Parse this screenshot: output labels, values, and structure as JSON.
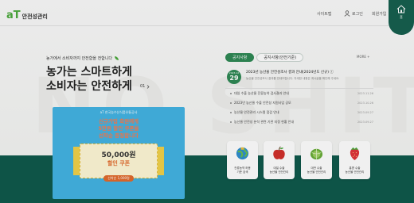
{
  "header": {
    "logo_mark": "aT",
    "logo_text": "안전성관리",
    "util_links": [
      "사이트맵",
      "로그인",
      "회원가입"
    ],
    "home_label": "홈"
  },
  "hero": {
    "tagline": "농가에서 소비자까지 안전함을 전합니다",
    "title_line1": "농가는 스마트하게",
    "title_line2": "소비자는 안전하게",
    "pager": "01"
  },
  "promo": {
    "brand": "aT 한국농수산식품유통공사",
    "headline_line1": "신규가입 회원에게",
    "headline_line2": "5만원 할인 쿠폰을",
    "headline_line3": "선착순 증정합니다",
    "ticket_amount": "50,000원",
    "ticket_desc": "할인 쿠폰",
    "ticket_note": "선착순 1,000명"
  },
  "notice": {
    "tabs": [
      "공지사항",
      "공지사항(안전기준)"
    ],
    "active_tab": 0,
    "more_label": "MORE +",
    "featured": {
      "month": "2023.12",
      "day": "29",
      "title": "2023년 농산물 안전성조사 결과 안내(2024년도 신규) ⓘ",
      "desc": "농산물 안전성조사 결과를 안내드립니다. 자세한 내용은 게시글을 확인해 주세요."
    },
    "items": [
      {
        "title": "대일 수출 농산물 잔류농약 검사결과 안내",
        "date": "2023.11.26"
      },
      {
        "title": "2023년 농산물 수출 안전성 지원사업 공모",
        "date": "2023.10.26"
      },
      {
        "title": "농산물 안전관리 시스템 점검 안내",
        "date": "2023.09.27"
      },
      {
        "title": "농산물 안전성 분석 관련 기관 지정 현황 안내",
        "date": "2023.09.27"
      }
    ]
  },
  "quick_links": [
    {
      "label_line1": "잔류농약 허용",
      "label_line2": "기준 검색",
      "icon": "globe-icon",
      "color": "#2f8fd0"
    },
    {
      "label_line1": "대일 수출",
      "label_line2": "농산물 안전관리",
      "icon": "apple-icon",
      "color": "#d2302b"
    },
    {
      "label_line1": "대만 수출",
      "label_line2": "농산물 안전관리",
      "icon": "cabbage-icon",
      "color": "#6aae3a"
    },
    {
      "label_line1": "홍콩 수출",
      "label_line2": "농산물 안전관리",
      "icon": "strawberry-icon",
      "color": "#e0353b"
    }
  ],
  "background_word": "NO SHIT",
  "colors": {
    "brand_green": "#2f8a55",
    "dark_green": "#0f5a4c",
    "promo_blue": "#43b4e4",
    "accent_orange": "#e36b2c"
  }
}
